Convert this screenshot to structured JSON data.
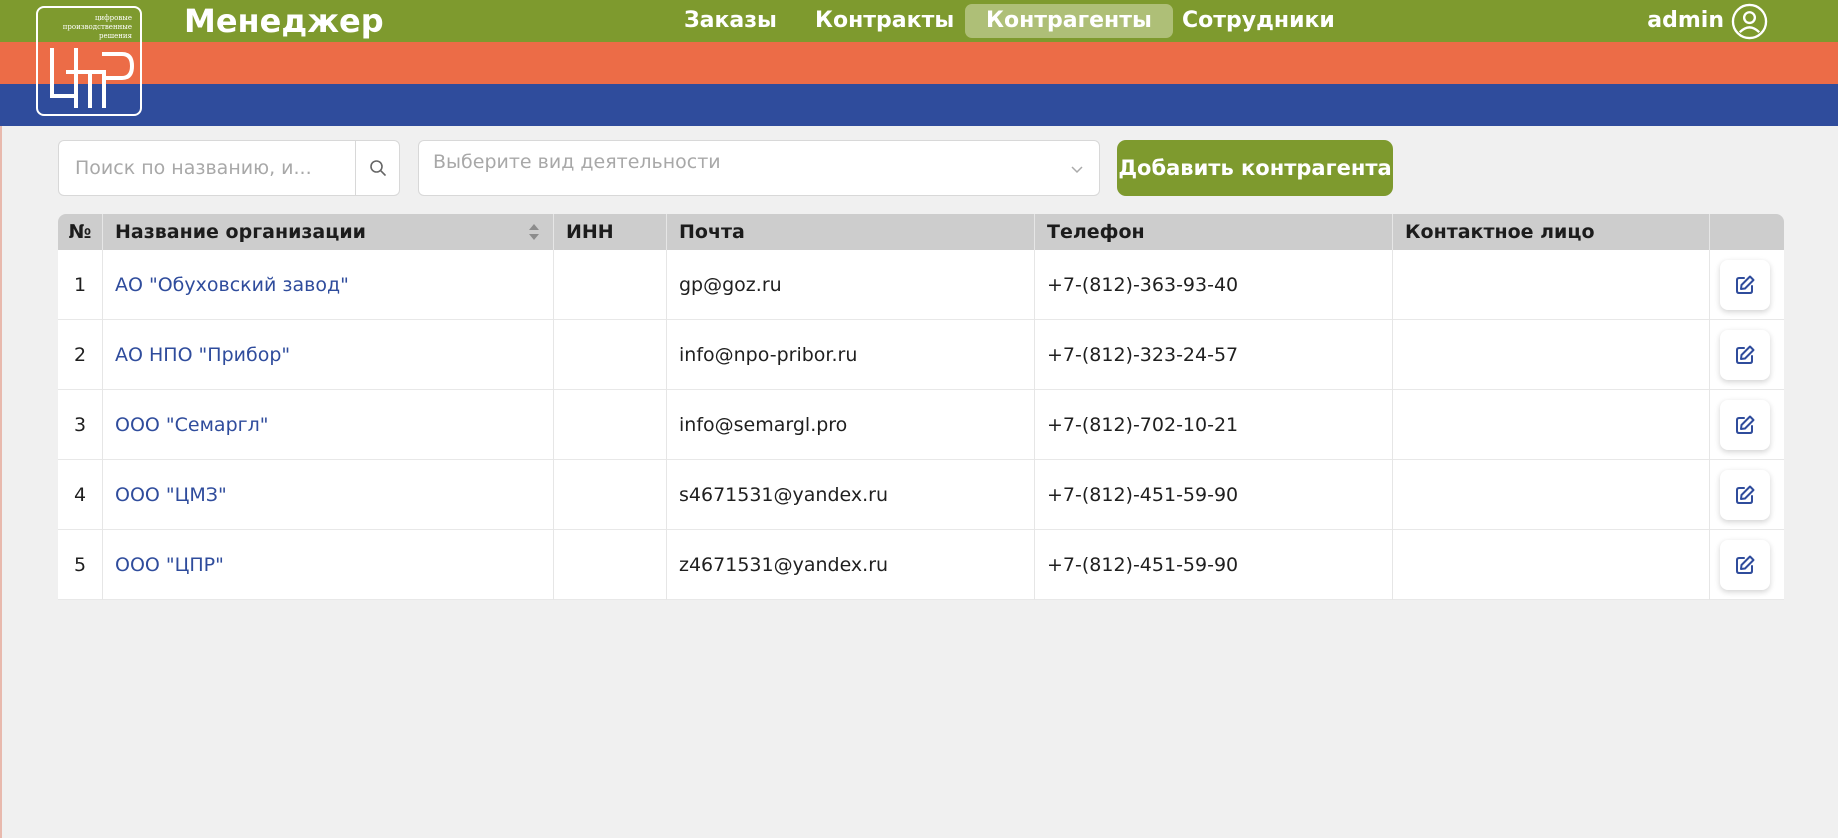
{
  "header": {
    "logo_tagline": "цифровые производственные решения",
    "logo_mark": "ЦПР",
    "app_title": "Менеджер",
    "nav": [
      {
        "label": "Заказы",
        "active": false
      },
      {
        "label": "Контракты",
        "active": false
      },
      {
        "label": "Контрагенты",
        "active": true
      },
      {
        "label": "Сотрудники",
        "active": false
      }
    ],
    "user": "admin"
  },
  "toolbar": {
    "search_placeholder": "Поиск по названию, и...",
    "activity_placeholder": "Выберите вид деятельности",
    "add_button": "Добавить контрагента"
  },
  "table": {
    "columns": [
      "№",
      "Название организации",
      "ИНН",
      "Почта",
      "Телефон",
      "Контактное лицо",
      ""
    ],
    "rows": [
      {
        "num": "1",
        "org": "АО \"Обуховский завод\"",
        "inn": "",
        "email": "gp@goz.ru",
        "phone": "+7-(812)-363-93-40",
        "contact": ""
      },
      {
        "num": "2",
        "org": "АО НПО \"Прибор\"",
        "inn": "",
        "email": "info@npo-pribor.ru",
        "phone": "+7-(812)-323-24-57",
        "contact": ""
      },
      {
        "num": "3",
        "org": "ООО \"Семаргл\"",
        "inn": "",
        "email": "info@semargl.pro",
        "phone": "+7-(812)-702-10-21",
        "contact": ""
      },
      {
        "num": "4",
        "org": "ООО \"ЦМЗ\"",
        "inn": "",
        "email": "s4671531@yandex.ru",
        "phone": "+7-(812)-451-59-90",
        "contact": ""
      },
      {
        "num": "5",
        "org": "ООО \"ЦПР\"",
        "inn": "",
        "email": "z4671531@yandex.ru",
        "phone": "+7-(812)-451-59-90",
        "contact": ""
      }
    ]
  },
  "colors": {
    "header_green": "#7e9a2e",
    "stripe_orange": "#ec6c47",
    "stripe_blue": "#2f4c9c",
    "link_blue": "#2f4c9c",
    "page_bg": "#f0f0f0"
  },
  "icons": {
    "search": "search-icon",
    "chevron": "chevron-down-icon",
    "user": "user-circle-icon",
    "edit": "edit-icon",
    "sort": "sort-icon"
  }
}
